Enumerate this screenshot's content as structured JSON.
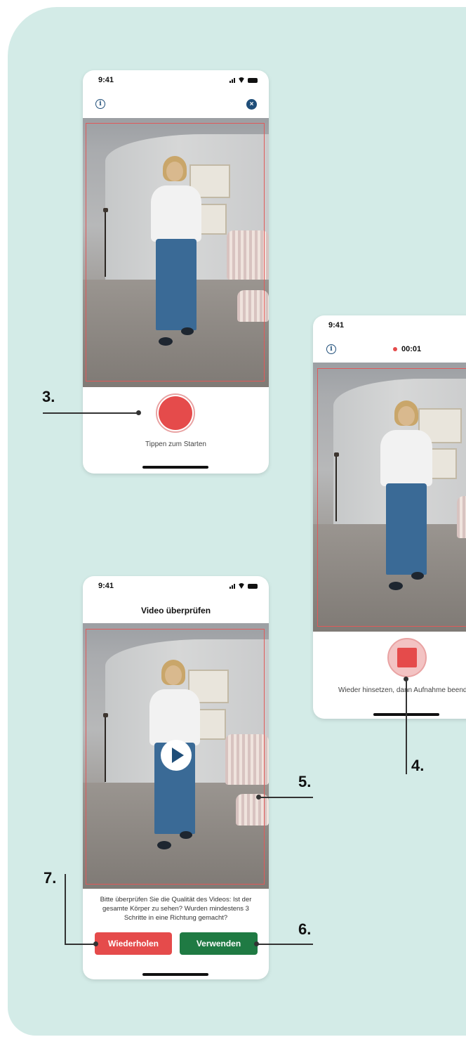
{
  "screen1": {
    "status_time": "9:41",
    "record_caption": "Tippen zum Starten"
  },
  "screen2": {
    "status_time": "9:41",
    "timer": "00:01",
    "stop_caption": "Wieder hinsetzen, dann Aufnahme beend"
  },
  "screen3": {
    "status_time": "9:41",
    "title": "Video überprüfen",
    "prompt": "Bitte überprüfen Sie die Qualität des Videos: Ist der gesamte Körper zu sehen? Wurden mindestens 3 Schritte in eine Richtung gemacht?",
    "retry_label": "Wiederholen",
    "use_label": "Verwenden"
  },
  "callouts": {
    "step3": "3.",
    "step4": "4.",
    "step5": "5.",
    "step6": "6.",
    "step7": "7."
  },
  "colors": {
    "background_panel": "#d3ebe7",
    "record_red": "#e54b4b",
    "use_green": "#1f7a43",
    "icon_blue": "#1f4e79"
  },
  "icons": [
    "info-icon",
    "close-icon",
    "signal-icon",
    "wifi-icon",
    "battery-icon",
    "record-button",
    "stop-button",
    "play-icon"
  ]
}
